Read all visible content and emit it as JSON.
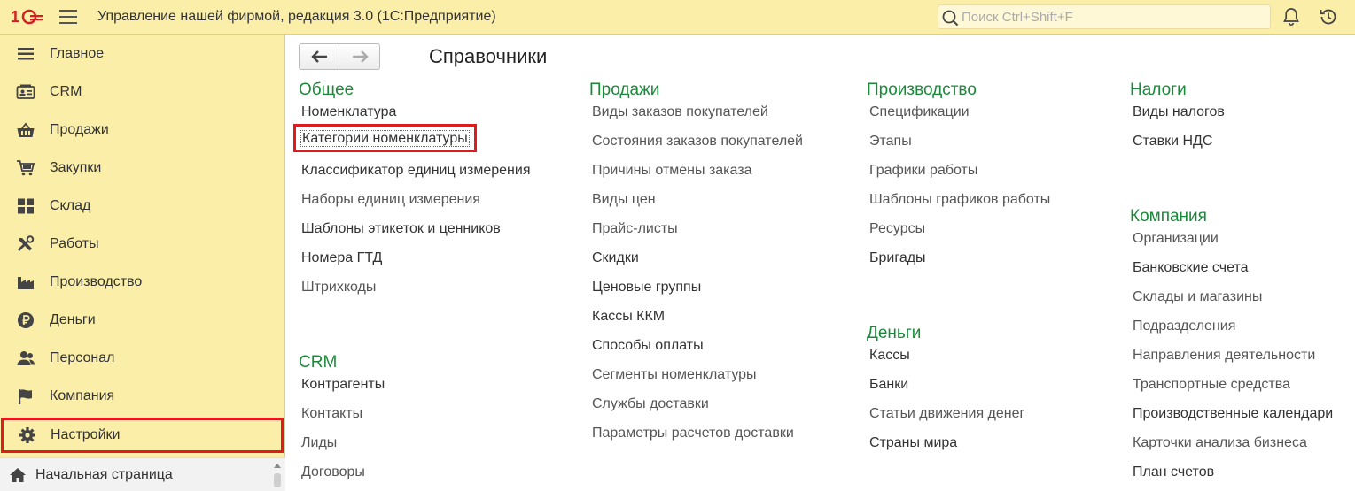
{
  "header": {
    "app_title": "Управление нашей фирмой, редакция 3.0  (1С:Предприятие)",
    "search_placeholder": "Поиск Ctrl+Shift+F"
  },
  "sidebar": {
    "items": [
      {
        "label": "Главное",
        "icon": "list-icon"
      },
      {
        "label": "CRM",
        "icon": "contact-card-icon"
      },
      {
        "label": "Продажи",
        "icon": "basket-icon"
      },
      {
        "label": "Закупки",
        "icon": "cart-icon"
      },
      {
        "label": "Склад",
        "icon": "warehouse-grid-icon"
      },
      {
        "label": "Работы",
        "icon": "tools-icon"
      },
      {
        "label": "Производство",
        "icon": "factory-icon"
      },
      {
        "label": "Деньги",
        "icon": "ruble-coin-icon"
      },
      {
        "label": "Персонал",
        "icon": "people-icon"
      },
      {
        "label": "Компания",
        "icon": "flag-icon"
      },
      {
        "label": "Настройки",
        "icon": "gear-icon"
      }
    ],
    "home_label": "Начальная страница"
  },
  "main": {
    "title": "Справочники",
    "columns": [
      {
        "sections": [
          {
            "title": "Общее",
            "links": [
              "Номенклатура",
              "Категории номенклатуры",
              "Классификатор единиц измерения",
              "Наборы единиц измерения",
              "Шаблоны этикеток и ценников",
              "Номера ГТД",
              "Штрихкоды"
            ]
          },
          {
            "title": "CRM",
            "links": [
              "Контрагенты",
              "Контакты",
              "Лиды",
              "Договоры"
            ]
          }
        ]
      },
      {
        "sections": [
          {
            "title": "Продажи",
            "links": [
              "Виды заказов покупателей",
              "Состояния заказов покупателей",
              "Причины отмены заказа",
              "Виды цен",
              "Прайс-листы",
              "Скидки",
              "Ценовые группы",
              "Кассы ККМ",
              "Способы оплаты",
              "Сегменты номенклатуры",
              "Службы доставки",
              "Параметры расчетов доставки"
            ]
          }
        ]
      },
      {
        "sections": [
          {
            "title": "Производство",
            "links": [
              "Спецификации",
              "Этапы",
              "Графики работы",
              "Шаблоны графиков работы",
              "Ресурсы",
              "Бригады"
            ]
          },
          {
            "title": "Деньги",
            "links": [
              "Кассы",
              "Банки",
              "Статьи движения денег",
              "Страны мира"
            ]
          }
        ]
      },
      {
        "sections": [
          {
            "title": "Налоги",
            "links": [
              "Виды налогов",
              "Ставки НДС"
            ]
          },
          {
            "title": "Компания",
            "links": [
              "Организации",
              "Банковские счета",
              "Склады и магазины",
              "Подразделения",
              "Направления деятельности",
              "Транспортные средства",
              "Производственные календари",
              "Карточки анализа бизнеса",
              "План счетов"
            ]
          }
        ]
      }
    ]
  },
  "colors": {
    "panel_bg": "#fbeea8",
    "section_title": "#1a8a3a",
    "highlight_border": "#e01b1b"
  }
}
